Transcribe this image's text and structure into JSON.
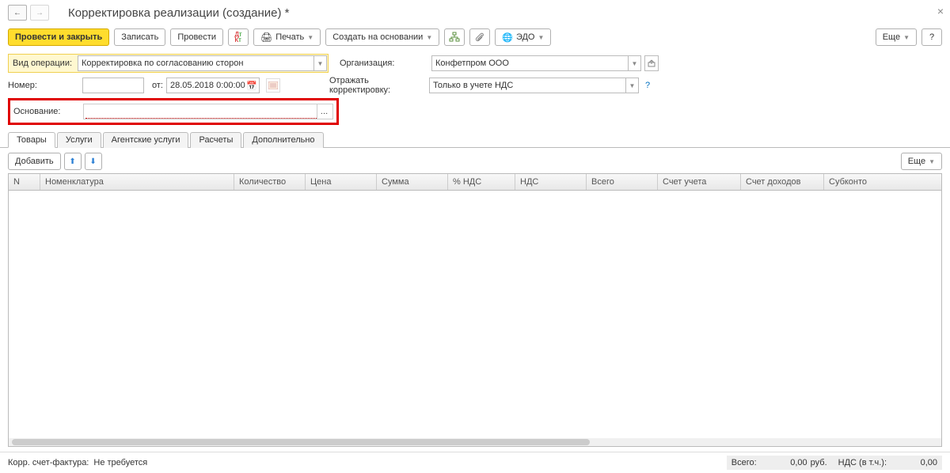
{
  "title": "Корректировка реализации (создание) *",
  "toolbar": {
    "postClose": "Провести и закрыть",
    "save": "Записать",
    "post": "Провести",
    "print": "Печать",
    "createBasedOn": "Создать на основании",
    "edo": "ЭДО",
    "more": "Еще"
  },
  "form": {
    "operationTypeLabel": "Вид операции:",
    "operationType": "Корректировка по согласованию сторон",
    "organizationLabel": "Организация:",
    "organization": "Конфетпром ООО",
    "numberLabel": "Номер:",
    "fromLabel": "от:",
    "date": "28.05.2018  0:00:00",
    "reflectLabel": "Отражать корректировку:",
    "reflect": "Только в учете НДС",
    "basisLabel": "Основание:"
  },
  "tabs": {
    "goods": "Товары",
    "services": "Услуги",
    "agentServices": "Агентские услуги",
    "calculations": "Расчеты",
    "additional": "Дополнительно"
  },
  "subToolbar": {
    "add": "Добавить",
    "more": "Еще"
  },
  "columns": {
    "n": "N",
    "nomenclature": "Номенклатура",
    "qty": "Количество",
    "price": "Цена",
    "sum": "Сумма",
    "vatPct": "% НДС",
    "vat": "НДС",
    "total": "Всего",
    "account": "Счет учета",
    "incomeAccount": "Счет доходов",
    "subconto": "Субконто"
  },
  "footer": {
    "corrInvoiceLabel": "Корр. счет-фактура:",
    "corrInvoice": "Не требуется",
    "totalLabel": "Всего:",
    "totalValue": "0,00",
    "currency": "руб.",
    "vatInclLabel": "НДС (в т.ч.):",
    "vatInclValue": "0,00"
  }
}
